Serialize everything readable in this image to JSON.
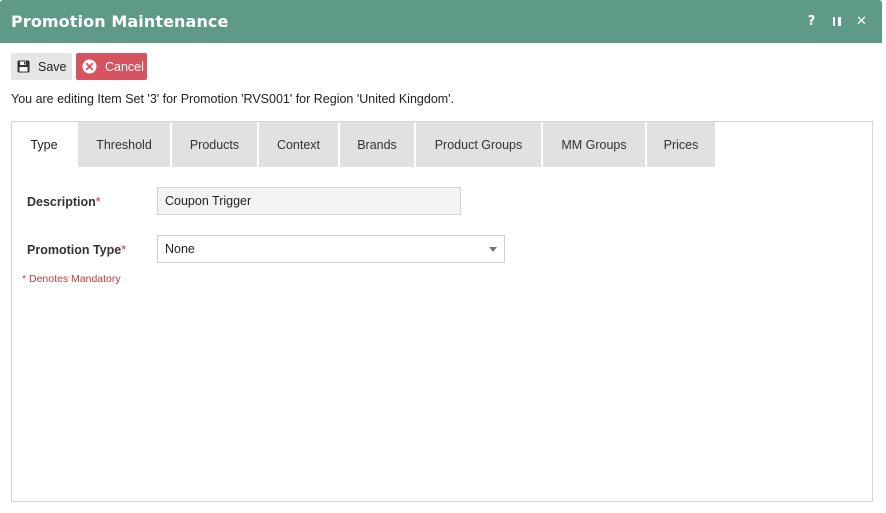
{
  "window": {
    "title": "Promotion Maintenance",
    "help_glyph": "?",
    "close_glyph": "✕"
  },
  "toolbar": {
    "save_label": "Save",
    "cancel_label": "Cancel"
  },
  "info_text": "You are editing Item Set '3' for Promotion 'RVS001' for Region 'United Kingdom'.",
  "tabs": [
    {
      "label": "Type",
      "active": true
    },
    {
      "label": "Threshold"
    },
    {
      "label": "Products"
    },
    {
      "label": "Context"
    },
    {
      "label": "Brands"
    },
    {
      "label": "Product Groups"
    },
    {
      "label": "MM Groups"
    },
    {
      "label": "Prices"
    }
  ],
  "form": {
    "description_label": "Description",
    "description_value": "Coupon Trigger",
    "promotion_type_label": "Promotion Type",
    "promotion_type_value": "None",
    "required_marker": "*",
    "mandatory_note": "* Denotes Mandatory"
  },
  "colors": {
    "titlebar": "#5e9a87",
    "cancel": "#d6545f",
    "required": "#c23b3b"
  }
}
